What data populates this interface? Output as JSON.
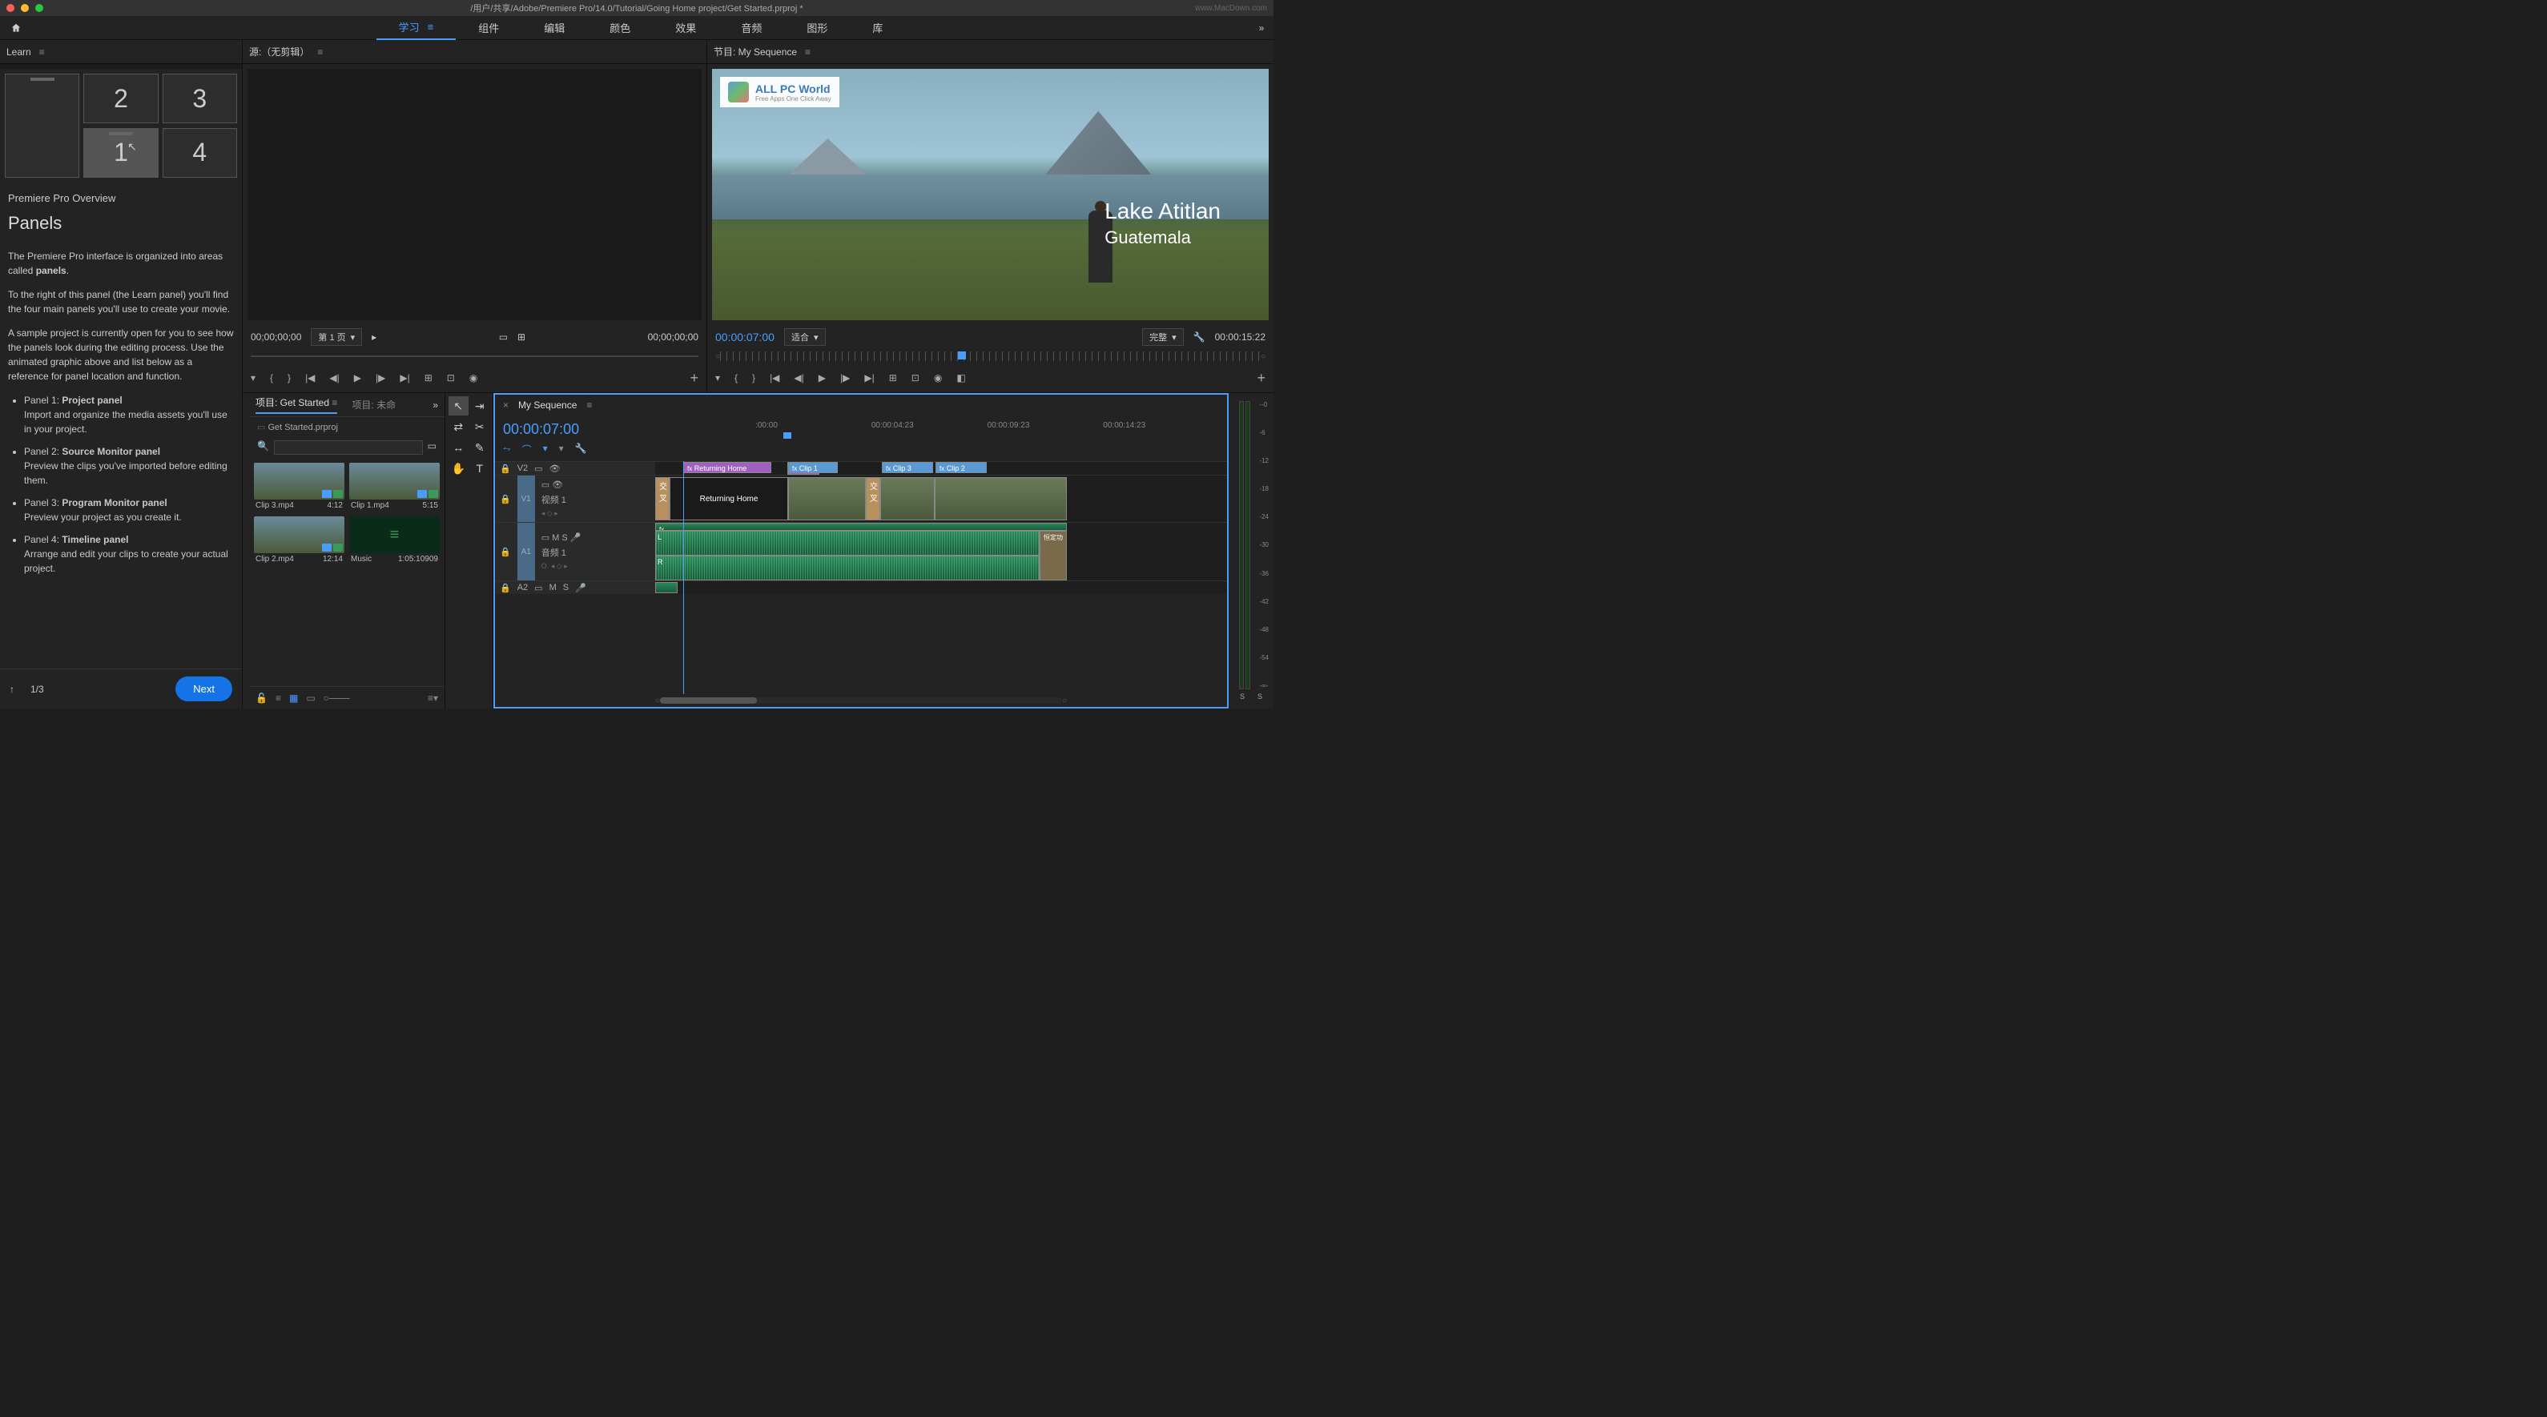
{
  "titlebar": {
    "path": "/用户/共享/Adobe/Premiere Pro/14.0/Tutorial/Going Home project/Get Started.prproj *",
    "url": "www.MacDown.com"
  },
  "workspaces": [
    "学习",
    "组件",
    "编辑",
    "颜色",
    "效果",
    "音频",
    "图形",
    "库"
  ],
  "learn": {
    "tab": "Learn",
    "cards": [
      "",
      "2",
      "3",
      "1",
      "4"
    ],
    "subtitle": "Premiere Pro Overview",
    "title": "Panels",
    "p1a": "The Premiere Pro interface is organized into areas called ",
    "p1b": "panels",
    "p2": "To the right of this panel (the Learn panel) you'll find the four main panels you'll use to create your movie.",
    "p3": "A sample project is currently open for you to see how the panels look during the editing process. Use the animated graphic above and list below as a reference for panel location and function.",
    "items": [
      {
        "pre": "Panel 1: ",
        "name": "Project panel",
        "desc": "Import and organize the media assets you'll use in your project."
      },
      {
        "pre": "Panel 2: ",
        "name": "Source Monitor panel",
        "desc": "Preview the clips you've imported before editing them."
      },
      {
        "pre": "Panel 3: ",
        "name": "Program Monitor panel",
        "desc": "Preview your project as you create it."
      },
      {
        "pre": "Panel 4: ",
        "name": "Timeline panel",
        "desc": "Arrange and edit your clips to create your actual project."
      }
    ],
    "page": "1/3",
    "next": "Next"
  },
  "source": {
    "tab": "源:（无剪辑）",
    "tc_left": "00;00;00;00",
    "page_dd": "第 1 页",
    "tc_right": "00;00;00;00"
  },
  "program": {
    "tab": "节目: My Sequence",
    "watermark_title": "ALL PC World",
    "watermark_sub": "Free Apps One Click Away",
    "overlay1": "Lake Atitlan",
    "overlay2": "Guatemala",
    "tc_left": "00:00:07:00",
    "fit_dd": "适合",
    "full_dd": "完整",
    "tc_right": "00:00:15:22"
  },
  "project": {
    "tab1": "项目: Get Started",
    "tab2": "项目: 未命",
    "file": "Get Started.prproj",
    "media": [
      {
        "name": "Clip 3.mp4",
        "dur": "4:12"
      },
      {
        "name": "Clip 1.mp4",
        "dur": "5:15"
      },
      {
        "name": "Clip 2.mp4",
        "dur": "12:14"
      },
      {
        "name": "Music",
        "dur": "1:05:10909"
      }
    ]
  },
  "timeline": {
    "tab": "My Sequence",
    "tc": "00:00:07:00",
    "ruler": [
      ":00:00",
      "00:00:04:23",
      "00:00:09:23",
      "00:00:14:23"
    ],
    "v2": "V2",
    "v1_code": "V1",
    "v1": "视频 1",
    "a1_code": "A1",
    "a1": "音频 1",
    "a2": "A2",
    "clip_returning": "Returning Home",
    "clip_label_returning": "Returning Home",
    "clip1": "Clip 1",
    "clip2": "Clip 2",
    "clip3": "Clip 3",
    "cross": "交叉",
    "const": "恒定功",
    "ms": "M",
    "ss": "S",
    "o": "O."
  },
  "meters": {
    "scale": [
      "--0",
      "-6",
      "-12",
      "-18",
      "-24",
      "-30",
      "-36",
      "-42",
      "-48",
      "-54",
      "-∞-"
    ],
    "labels": [
      "S",
      "S"
    ]
  }
}
